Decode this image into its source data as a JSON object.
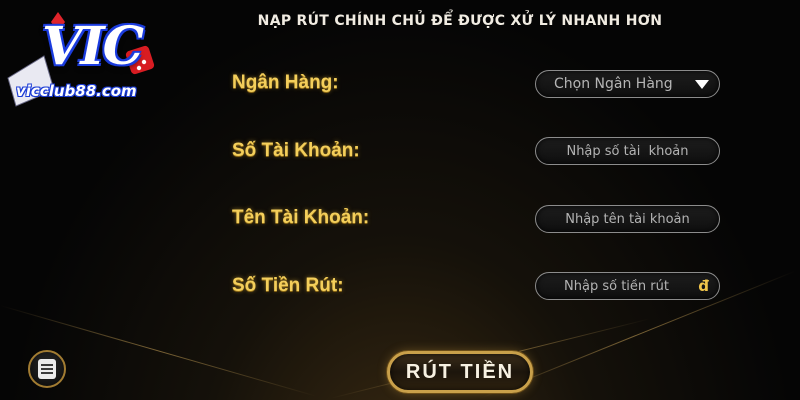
{
  "logo": {
    "brand": "VIC",
    "domain": "vicclub88.com"
  },
  "header": {
    "title": "NẠP RÚT CHÍNH CHỦ ĐỂ ĐƯỢC XỬ LÝ NHANH HƠN"
  },
  "form": {
    "bank": {
      "label": "Ngân Hàng:",
      "value": "Chọn Ngân Hàng"
    },
    "account_number": {
      "label": "Số Tài Khoản:",
      "placeholder": "Nhập số tài  khoản"
    },
    "account_name": {
      "label": "Tên Tài Khoản:",
      "placeholder": "Nhập tên tài khoản"
    },
    "amount": {
      "label": "Số Tiền Rút:",
      "placeholder": "Nhập số tiền rút",
      "currency": "đ"
    }
  },
  "actions": {
    "withdraw_label": "RÚT TIỀN"
  },
  "colors": {
    "label_gold": "#f4cf5b",
    "button_border": "#c9a04a",
    "background": "#050505"
  }
}
